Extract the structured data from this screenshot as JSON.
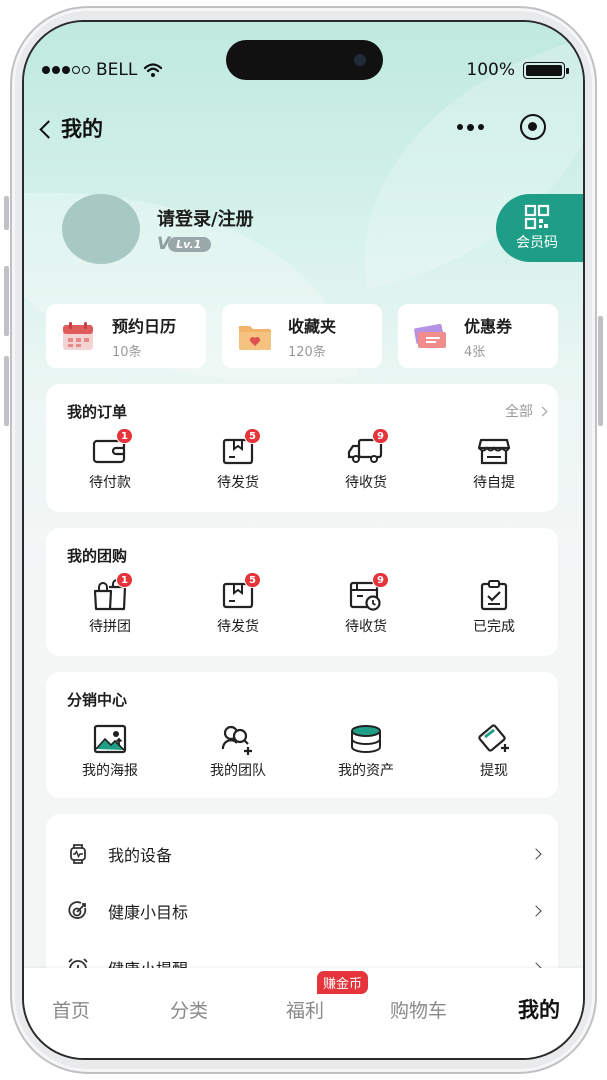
{
  "status_bar": {
    "carrier": "BELL",
    "battery": "100%",
    "icons": [
      "signal-dots-icon",
      "wifi-icon",
      "battery-icon"
    ]
  },
  "navbar": {
    "title": "我的",
    "icons": [
      "back-chevron-icon",
      "more-dots-icon",
      "target-icon"
    ]
  },
  "profile": {
    "login_label": "请登录/注册",
    "level_prefix": "V",
    "level": "Lv.1",
    "member_code_label": "会员码"
  },
  "quick_cards": [
    {
      "title": "预约日历",
      "sub": "10条",
      "icon": "calendar-icon"
    },
    {
      "title": "收藏夹",
      "sub": "120条",
      "icon": "folder-heart-icon"
    },
    {
      "title": "优惠券",
      "sub": "4张",
      "icon": "coupon-icon"
    }
  ],
  "orders": {
    "title": "我的订单",
    "all_label": "全部",
    "items": [
      {
        "label": "待付款",
        "badge": "1",
        "icon": "wallet-icon"
      },
      {
        "label": "待发货",
        "badge": "5",
        "icon": "package-icon"
      },
      {
        "label": "待收货",
        "badge": "9",
        "icon": "truck-icon"
      },
      {
        "label": "待自提",
        "badge": "",
        "icon": "store-icon"
      }
    ]
  },
  "group_buy": {
    "title": "我的团购",
    "items": [
      {
        "label": "待拼团",
        "badge": "1",
        "icon": "shopping-bags-icon"
      },
      {
        "label": "待发货",
        "badge": "5",
        "icon": "package-icon"
      },
      {
        "label": "待收货",
        "badge": "9",
        "icon": "box-clock-icon"
      },
      {
        "label": "已完成",
        "badge": "",
        "icon": "clipboard-check-icon"
      }
    ]
  },
  "distribution": {
    "title": "分销中心",
    "items": [
      {
        "label": "我的海报",
        "icon": "poster-image-icon"
      },
      {
        "label": "我的团队",
        "icon": "add-member-icon"
      },
      {
        "label": "我的资产",
        "icon": "coin-stack-icon"
      },
      {
        "label": "提现",
        "icon": "card-withdraw-icon"
      }
    ]
  },
  "menu_list": [
    {
      "label": "我的设备",
      "icon": "smartwatch-icon"
    },
    {
      "label": "健康小目标",
      "icon": "goal-target-icon"
    },
    {
      "label": "健康小提醒",
      "icon": "alarm-clock-icon"
    }
  ],
  "tabbar": {
    "tabs": [
      {
        "label": "首页"
      },
      {
        "label": "分类"
      },
      {
        "label": "福利"
      },
      {
        "label": "购物车"
      },
      {
        "label": "我的"
      }
    ],
    "active": "我的",
    "welfare_badge": "赚金币"
  },
  "colors": {
    "accent": "#1e9e86",
    "badge": "#e6343c",
    "hero_top": "#bfe9df"
  }
}
